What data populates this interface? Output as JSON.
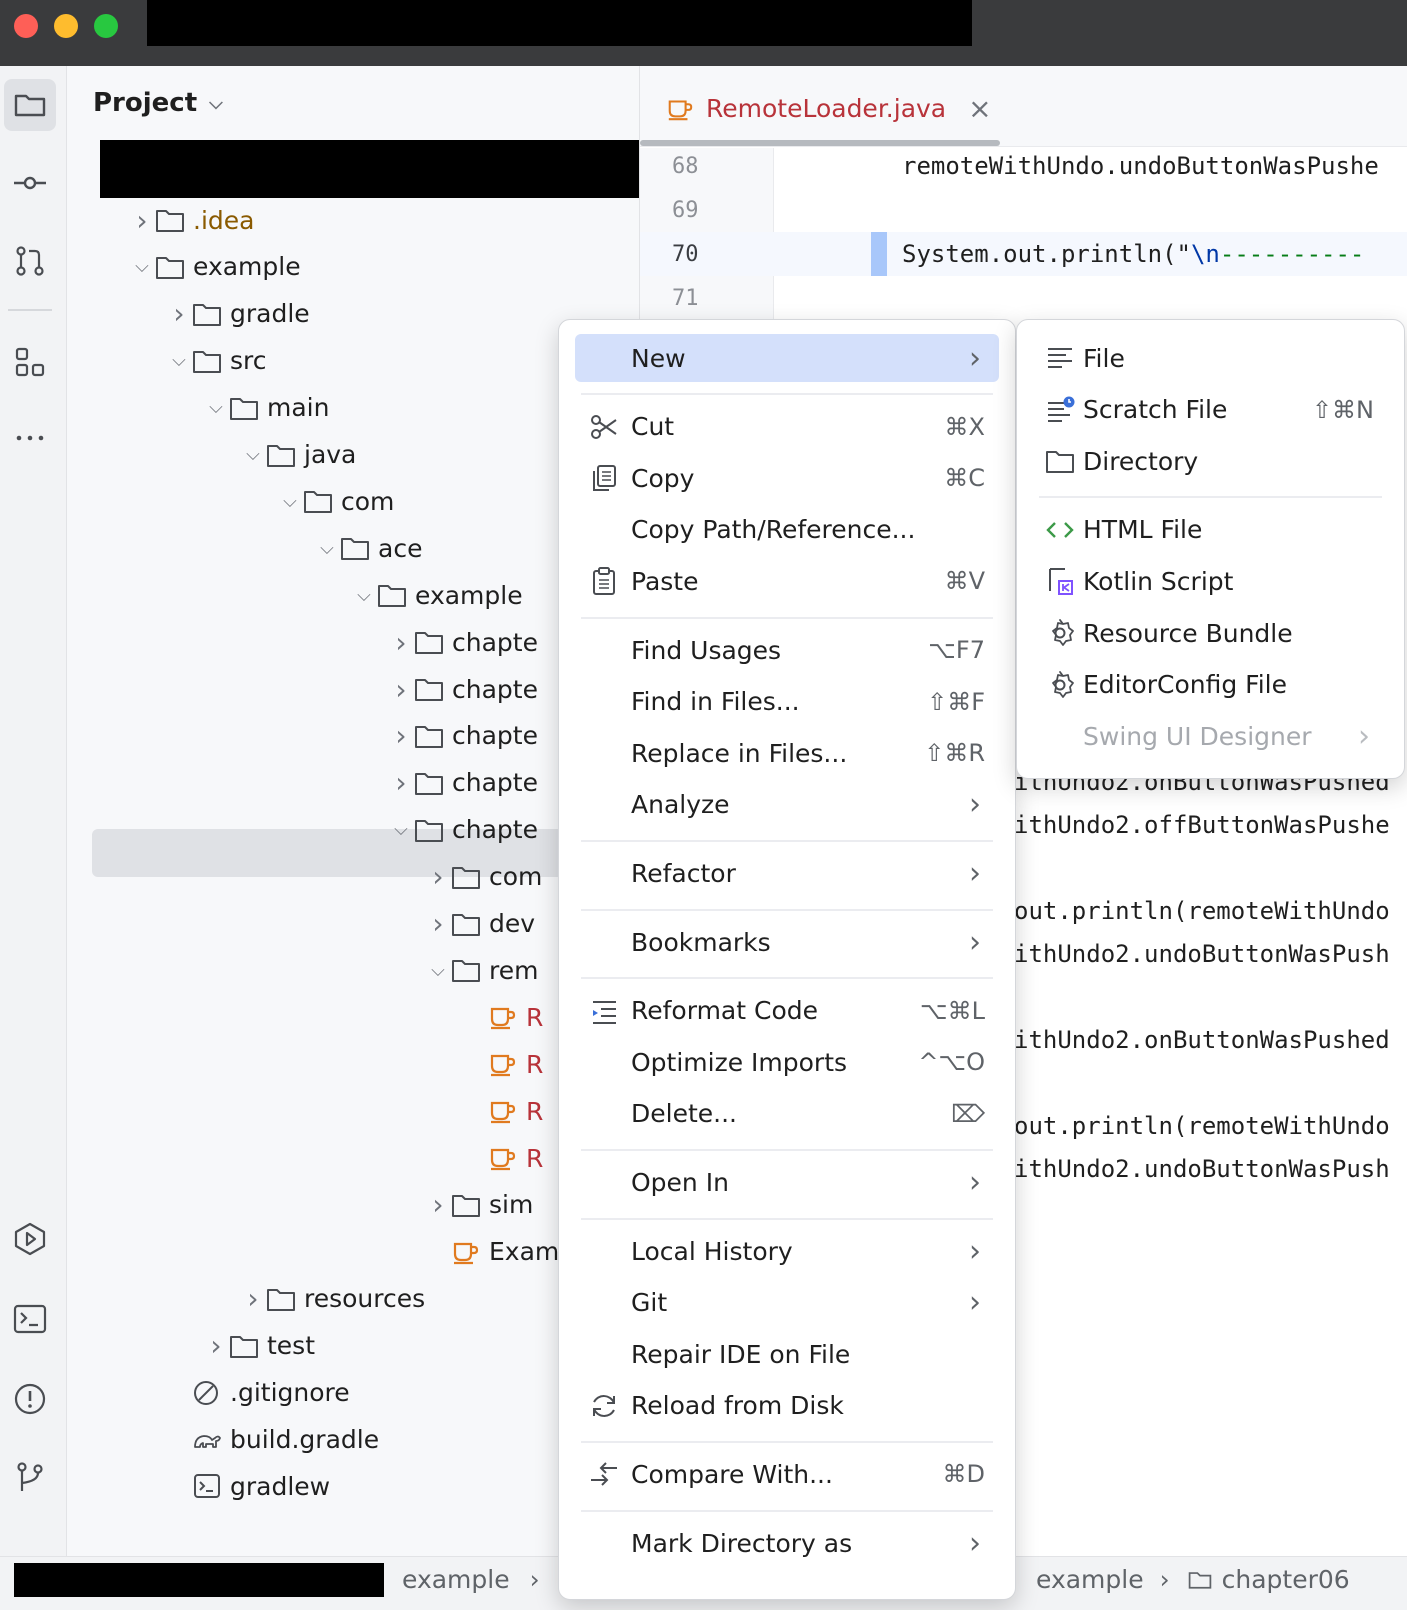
{
  "project": {
    "title": "Project",
    "tree": [
      {
        "label": ".idea",
        "depth": 1,
        "expanded": false,
        "kind": "folder",
        "color": "#8a5a00"
      },
      {
        "label": "example",
        "depth": 1,
        "expanded": true,
        "kind": "folder"
      },
      {
        "label": "gradle",
        "depth": 2,
        "expanded": false,
        "kind": "folder"
      },
      {
        "label": "src",
        "depth": 2,
        "expanded": true,
        "kind": "folder"
      },
      {
        "label": "main",
        "depth": 3,
        "expanded": true,
        "kind": "folder"
      },
      {
        "label": "java",
        "depth": 4,
        "expanded": true,
        "kind": "folder"
      },
      {
        "label": "com",
        "depth": 5,
        "expanded": true,
        "kind": "folder"
      },
      {
        "label": "ace",
        "depth": 6,
        "expanded": true,
        "kind": "folder"
      },
      {
        "label": "example",
        "depth": 7,
        "expanded": true,
        "kind": "folder"
      },
      {
        "label": "chapte",
        "depth": 8,
        "expanded": false,
        "kind": "folder"
      },
      {
        "label": "chapte",
        "depth": 8,
        "expanded": false,
        "kind": "folder"
      },
      {
        "label": "chapte",
        "depth": 8,
        "expanded": false,
        "kind": "folder"
      },
      {
        "label": "chapte",
        "depth": 8,
        "expanded": false,
        "kind": "folder"
      },
      {
        "label": "chapte",
        "depth": 8,
        "expanded": true,
        "kind": "folder",
        "selected": true
      },
      {
        "label": "com",
        "depth": 9,
        "expanded": false,
        "kind": "folder"
      },
      {
        "label": "dev",
        "depth": 9,
        "expanded": false,
        "kind": "folder"
      },
      {
        "label": "rem",
        "depth": 9,
        "expanded": true,
        "kind": "folder"
      },
      {
        "label": "R",
        "depth": 10,
        "kind": "java"
      },
      {
        "label": "R",
        "depth": 10,
        "kind": "java"
      },
      {
        "label": "R",
        "depth": 10,
        "kind": "java"
      },
      {
        "label": "R",
        "depth": 10,
        "kind": "java"
      },
      {
        "label": "sim",
        "depth": 9,
        "expanded": false,
        "kind": "folder"
      },
      {
        "label": "Examp",
        "depth": 9,
        "kind": "java-plain"
      },
      {
        "label": "resources",
        "depth": 4,
        "expanded": false,
        "kind": "folder"
      },
      {
        "label": "test",
        "depth": 3,
        "expanded": false,
        "kind": "folder"
      },
      {
        "label": ".gitignore",
        "depth": 2,
        "kind": "ignore"
      },
      {
        "label": "build.gradle",
        "depth": 2,
        "kind": "gradle"
      },
      {
        "label": "gradlew",
        "depth": 2,
        "kind": "terminal"
      }
    ]
  },
  "editor": {
    "tab": {
      "label": "RemoteLoader.java",
      "close": "×"
    },
    "line_numbers": [
      "68",
      "69",
      "70",
      "71"
    ],
    "lines": [
      {
        "text": "remoteWithUndo.undoButtonWasPushe"
      },
      {
        "text": ""
      },
      {
        "text_a": "System.out.println(\"",
        "text_b": "\\n",
        "text_c": "----------"
      },
      {
        "text": ""
      }
    ],
    "right_lines": [
      "ithUndo2.onButtonWasPushed",
      "ithUndo2.offButtonWasPushe",
      "out.println(remoteWithUndo",
      "ithUndo2.undoButtonWasPush",
      "ithUndo2.onButtonWasPushed",
      "out.println(remoteWithUndo",
      "ithUndo2.undoButtonWasPush"
    ]
  },
  "context_menu": {
    "items": [
      {
        "label": "New",
        "shortcut": "",
        "submenu": true,
        "highlighted": true,
        "icon": ""
      },
      {
        "sep": true
      },
      {
        "label": "Cut",
        "shortcut": "⌘X",
        "icon": "scissors-icon"
      },
      {
        "label": "Copy",
        "shortcut": "⌘C",
        "icon": "copy-icon"
      },
      {
        "label": "Copy Path/Reference...",
        "shortcut": "",
        "icon": ""
      },
      {
        "label": "Paste",
        "shortcut": "⌘V",
        "icon": "paste-icon"
      },
      {
        "sep": true
      },
      {
        "label": "Find Usages",
        "shortcut": "⌥F7",
        "icon": ""
      },
      {
        "label": "Find in Files...",
        "shortcut": "⇧⌘F",
        "icon": ""
      },
      {
        "label": "Replace in Files...",
        "shortcut": "⇧⌘R",
        "icon": ""
      },
      {
        "label": "Analyze",
        "shortcut": "",
        "submenu": true,
        "icon": ""
      },
      {
        "sep": true
      },
      {
        "label": "Refactor",
        "shortcut": "",
        "submenu": true,
        "icon": ""
      },
      {
        "sep": true
      },
      {
        "label": "Bookmarks",
        "shortcut": "",
        "submenu": true,
        "icon": ""
      },
      {
        "sep": true
      },
      {
        "label": "Reformat Code",
        "shortcut": "⌥⌘L",
        "icon": "reformat-icon"
      },
      {
        "label": "Optimize Imports",
        "shortcut": "^⌥O",
        "icon": ""
      },
      {
        "label": "Delete...",
        "shortcut": "⌦",
        "icon": ""
      },
      {
        "sep": true
      },
      {
        "label": "Open In",
        "shortcut": "",
        "submenu": true,
        "icon": ""
      },
      {
        "sep": true
      },
      {
        "label": "Local History",
        "shortcut": "",
        "submenu": true,
        "icon": ""
      },
      {
        "label": "Git",
        "shortcut": "",
        "submenu": true,
        "icon": ""
      },
      {
        "label": "Repair IDE on File",
        "shortcut": "",
        "icon": ""
      },
      {
        "label": "Reload from Disk",
        "shortcut": "",
        "icon": "reload-icon"
      },
      {
        "sep": true
      },
      {
        "label": "Compare With...",
        "shortcut": "⌘D",
        "icon": "compare-icon"
      },
      {
        "sep": true
      },
      {
        "label": "Mark Directory as",
        "shortcut": "",
        "submenu": true,
        "icon": ""
      }
    ]
  },
  "new_submenu": {
    "items": [
      {
        "label": "File",
        "shortcut": "",
        "icon": "file-lines-icon"
      },
      {
        "label": "Scratch File",
        "shortcut": "⇧⌘N",
        "icon": "scratch-file-icon"
      },
      {
        "label": "Directory",
        "shortcut": "",
        "icon": "folder-icon"
      },
      {
        "sep": true
      },
      {
        "label": "HTML File",
        "shortcut": "",
        "icon": "html-icon"
      },
      {
        "label": "Kotlin Script",
        "shortcut": "",
        "icon": "kotlin-script-icon"
      },
      {
        "label": "Resource Bundle",
        "shortcut": "",
        "icon": "gear-icon"
      },
      {
        "label": "EditorConfig File",
        "shortcut": "",
        "icon": "gear-icon"
      },
      {
        "label": "Swing UI Designer",
        "shortcut": "",
        "submenu": true,
        "disabled": true,
        "icon": ""
      }
    ]
  },
  "statusbar": {
    "left_crumb": "example",
    "left_sep": "›",
    "right_crumb_1": "example",
    "right_sep": "›",
    "right_crumb_2": "chapter06"
  },
  "colors": {
    "menu_highlight": "#d4e0fb",
    "java_icon": "#e07a1f",
    "tab_text": "#b8333a",
    "selected_row": "#dfe1e5",
    "caret_line": "#a8c7fa"
  }
}
